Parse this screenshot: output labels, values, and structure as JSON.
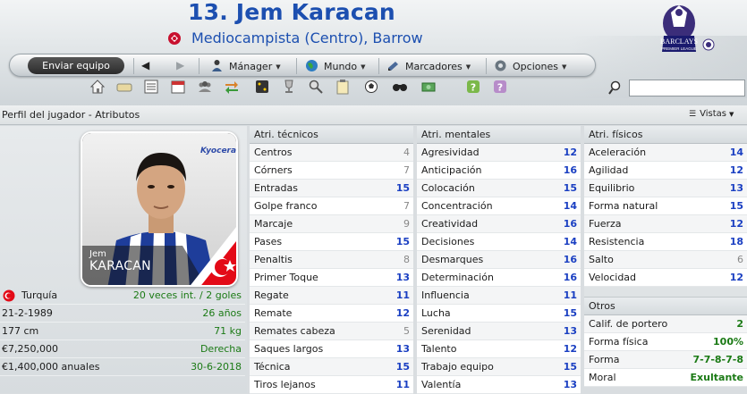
{
  "header": {
    "title": "13. Jem Karacan",
    "subtitle": "Mediocampista (Centro), Barrow",
    "league_logo_text": "BARCLAYS",
    "league_logo_sub": "PREMIER LEAGUE"
  },
  "nav": {
    "continue_label": "Enviar equipo",
    "back_icon": "back-arrow-icon",
    "forward_icon": "forward-arrow-icon",
    "items": [
      {
        "label": "Mánager",
        "icon": "manager-icon"
      },
      {
        "label": "Mundo",
        "icon": "globe-icon"
      },
      {
        "label": "Marcadores",
        "icon": "bookmarks-icon"
      },
      {
        "label": "Opciones",
        "icon": "options-icon"
      }
    ]
  },
  "search": {
    "value": ""
  },
  "section": {
    "title": "Perfil del jugador - Atributos",
    "views_label": "Vistas"
  },
  "player": {
    "first_name": "Jem",
    "last_name": "KARACAN",
    "info": [
      {
        "label": "Turquía",
        "value": "20 veces int. / 2 goles"
      },
      {
        "label": "21-2-1989",
        "value": "26 años"
      },
      {
        "label": "177 cm",
        "value": "71 kg"
      },
      {
        "label": "€7,250,000",
        "value": "Derecha"
      },
      {
        "label": "€1,400,000 anuales",
        "value": "30-6-2018"
      }
    ]
  },
  "technical": {
    "heading": "Atri. técnicos",
    "rows": [
      {
        "label": "Centros",
        "value": "4",
        "tone": "gray"
      },
      {
        "label": "Córners",
        "value": "7",
        "tone": "gray"
      },
      {
        "label": "Entradas",
        "value": "15",
        "tone": "blue"
      },
      {
        "label": "Golpe franco",
        "value": "7",
        "tone": "gray"
      },
      {
        "label": "Marcaje",
        "value": "9",
        "tone": "gray"
      },
      {
        "label": "Pases",
        "value": "15",
        "tone": "blue"
      },
      {
        "label": "Penaltis",
        "value": "8",
        "tone": "gray"
      },
      {
        "label": "Primer Toque",
        "value": "13",
        "tone": "blue"
      },
      {
        "label": "Regate",
        "value": "11",
        "tone": "blue"
      },
      {
        "label": "Remate",
        "value": "12",
        "tone": "blue"
      },
      {
        "label": "Remates cabeza",
        "value": "5",
        "tone": "gray"
      },
      {
        "label": "Saques largos",
        "value": "13",
        "tone": "blue"
      },
      {
        "label": "Técnica",
        "value": "15",
        "tone": "blue"
      },
      {
        "label": "Tiros lejanos",
        "value": "11",
        "tone": "blue"
      }
    ]
  },
  "mental": {
    "heading": "Atri. mentales",
    "rows": [
      {
        "label": "Agresividad",
        "value": "12",
        "tone": "blue"
      },
      {
        "label": "Anticipación",
        "value": "16",
        "tone": "blue"
      },
      {
        "label": "Colocación",
        "value": "15",
        "tone": "blue"
      },
      {
        "label": "Concentración",
        "value": "14",
        "tone": "blue"
      },
      {
        "label": "Creatividad",
        "value": "16",
        "tone": "blue"
      },
      {
        "label": "Decisiones",
        "value": "14",
        "tone": "blue"
      },
      {
        "label": "Desmarques",
        "value": "16",
        "tone": "blue"
      },
      {
        "label": "Determinación",
        "value": "16",
        "tone": "blue"
      },
      {
        "label": "Influencia",
        "value": "11",
        "tone": "blue"
      },
      {
        "label": "Lucha",
        "value": "15",
        "tone": "blue"
      },
      {
        "label": "Serenidad",
        "value": "13",
        "tone": "blue"
      },
      {
        "label": "Talento",
        "value": "12",
        "tone": "blue"
      },
      {
        "label": "Trabajo equipo",
        "value": "15",
        "tone": "blue"
      },
      {
        "label": "Valentía",
        "value": "13",
        "tone": "blue"
      }
    ]
  },
  "physical": {
    "heading": "Atri. físicos",
    "rows": [
      {
        "label": "Aceleración",
        "value": "14",
        "tone": "blue"
      },
      {
        "label": "Agilidad",
        "value": "12",
        "tone": "blue"
      },
      {
        "label": "Equilibrio",
        "value": "13",
        "tone": "blue"
      },
      {
        "label": "Forma natural",
        "value": "15",
        "tone": "blue"
      },
      {
        "label": "Fuerza",
        "value": "12",
        "tone": "blue"
      },
      {
        "label": "Resistencia",
        "value": "18",
        "tone": "blue"
      },
      {
        "label": "Salto",
        "value": "6",
        "tone": "gray"
      },
      {
        "label": "Velocidad",
        "value": "12",
        "tone": "blue"
      }
    ]
  },
  "other": {
    "heading": "Otros",
    "rows": [
      {
        "label": "Calif. de portero",
        "value": "2",
        "tone": "green"
      },
      {
        "label": "Forma física",
        "value": "100%",
        "tone": "green"
      },
      {
        "label": "Forma",
        "value": "7-7-8-7-8",
        "tone": "green"
      },
      {
        "label": "Moral",
        "value": "Exultante",
        "tone": "green"
      }
    ]
  },
  "colors": {
    "title_blue": "#1c4fb0",
    "value_blue": "#1a3fc2",
    "value_green": "#1b7a15",
    "value_gray": "#888888"
  }
}
